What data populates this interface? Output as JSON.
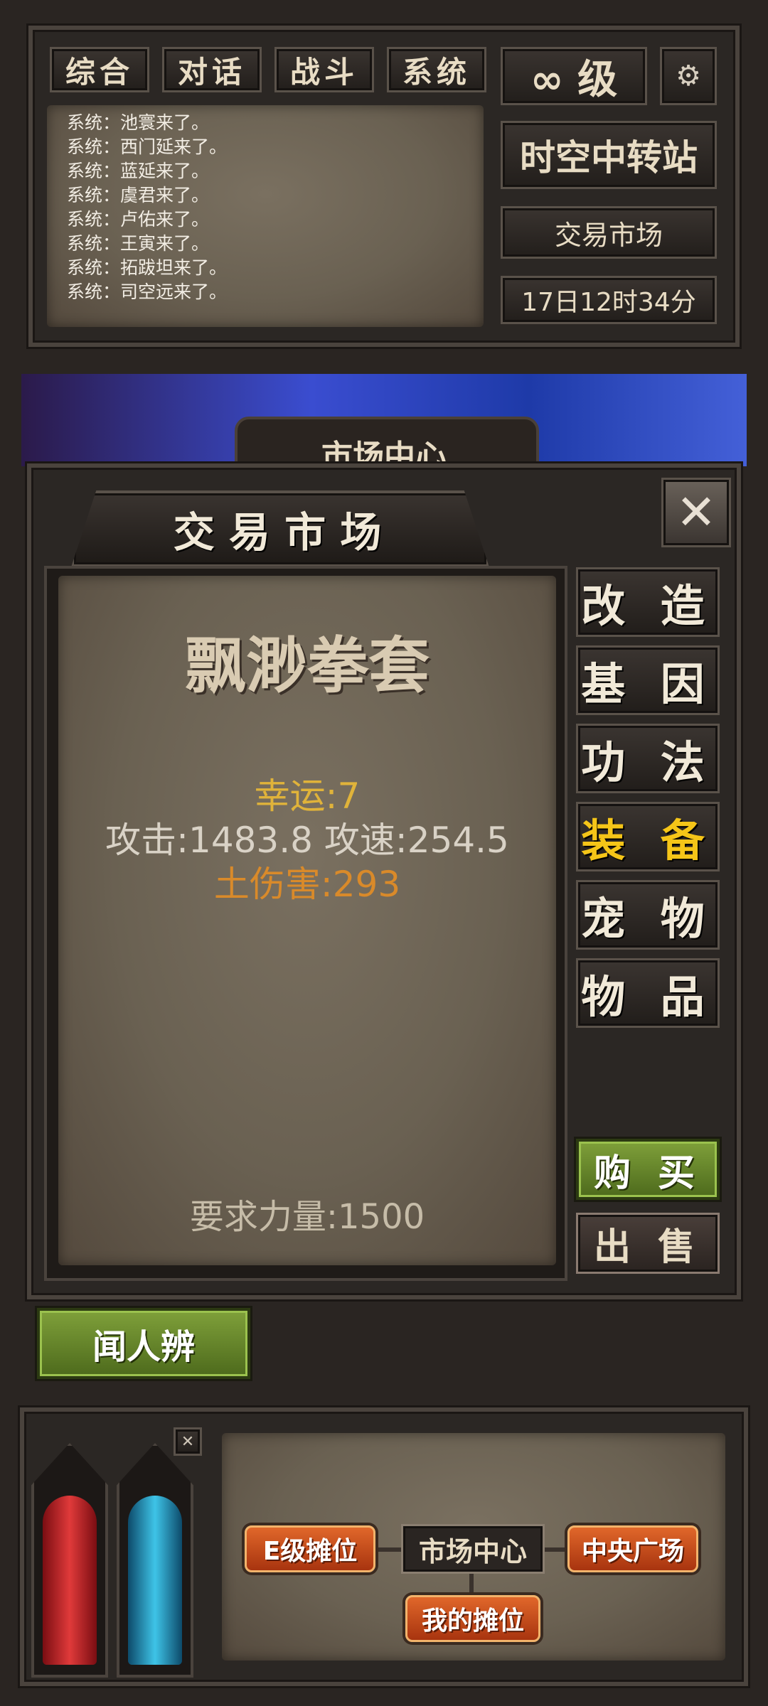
{
  "chat": {
    "tabs": [
      "综合",
      "对话",
      "战斗",
      "系统"
    ],
    "lines": [
      "系统：池寰来了。",
      "系统：西门延来了。",
      "系统：蓝延来了。",
      "系统：虞君来了。",
      "系统：卢佑来了。",
      "系统：王寅来了。",
      "系统：拓跋坦来了。",
      "系统：司空远来了。"
    ]
  },
  "status": {
    "level": "∞ 级",
    "location": "时空中转站",
    "zone": "交易市场",
    "time": "17日12时34分"
  },
  "background_banner": "市场中心",
  "market": {
    "title": "交 易 市 场",
    "item": {
      "name": "飘渺拳套",
      "luck": "幸运:7",
      "stats": "攻击:1483.8 攻速:254.5",
      "element": "土伤害:293",
      "requirement": "要求力量:1500"
    },
    "categories": [
      "改 造",
      "基 因",
      "功 法",
      "装 备",
      "宠 物",
      "物 品"
    ],
    "active_category": 3,
    "buy_label": "购 买",
    "sell_label": "出 售"
  },
  "npc_button": "闻人辨",
  "map": {
    "nodes": [
      "E级摊位",
      "市场中心",
      "中央广场",
      "我的摊位"
    ]
  },
  "colors": {
    "active_category": "#f5c518",
    "luck": "#e0b33a",
    "element": "#d98a2a",
    "stats": "#d9d2c6",
    "hp": "#c8262a",
    "mp": "#2aa8d8"
  },
  "icons": [
    "gear-icon",
    "close-icon",
    "infinity-icon"
  ]
}
